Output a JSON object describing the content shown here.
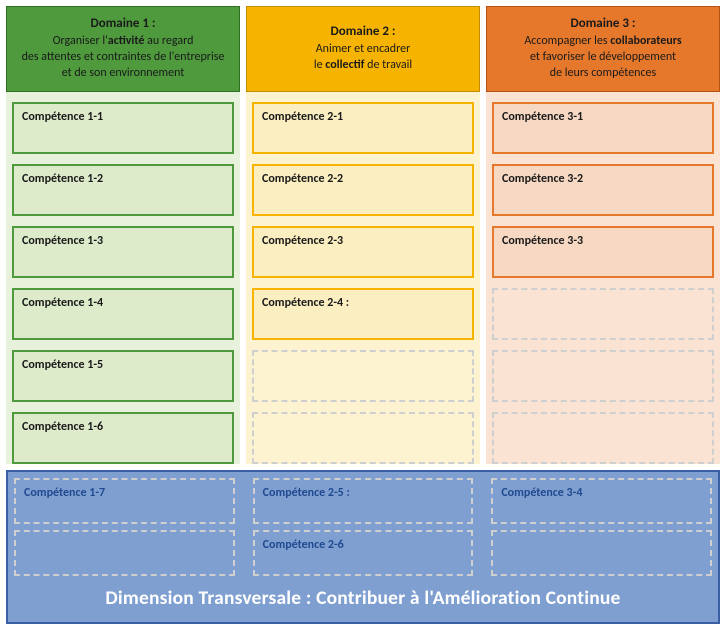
{
  "headers": [
    {
      "title_pre": "Domaine 1 :",
      "line1": "Organiser l'",
      "em": "activité",
      "line1b": " au regard",
      "line2": "des attentes et contraintes de l'entreprise",
      "line3": "et de son environnement"
    },
    {
      "title_pre": "Domaine 2 :",
      "line1": "Animer et encadrer",
      "em": "collectif",
      "line2pre": "le ",
      "line2post": " de travail"
    },
    {
      "title_pre": "Domaine 3 :",
      "line1": "Accompagner les ",
      "em": "collaborateurs",
      "line2": "et favoriser le développement",
      "line3": "de leurs compétences"
    }
  ],
  "columns": [
    {
      "cells": [
        "Compétence 1-1",
        "Compétence 1-2",
        "Compétence 1-3",
        "Compétence 1-4",
        "Compétence 1-5",
        "Compétence 1-6"
      ],
      "gaps": 0
    },
    {
      "cells": [
        "Compétence 2-1",
        "Compétence 2-2",
        "Compétence 2-3",
        "Compétence 2-4 :"
      ],
      "gaps": 2
    },
    {
      "cells": [
        "Compétence 3-1",
        "Compétence 3-2",
        "Compétence 3-3"
      ],
      "gaps": 3
    }
  ],
  "transversal": {
    "col1": [
      "Compétence 1-7"
    ],
    "col2": [
      "Compétence 2-5 :",
      "Compétence 2-6"
    ],
    "col3": [
      "Compétence 3-4"
    ],
    "footer": "Dimension Transversale : Contribuer à l'Amélioration Continue"
  }
}
